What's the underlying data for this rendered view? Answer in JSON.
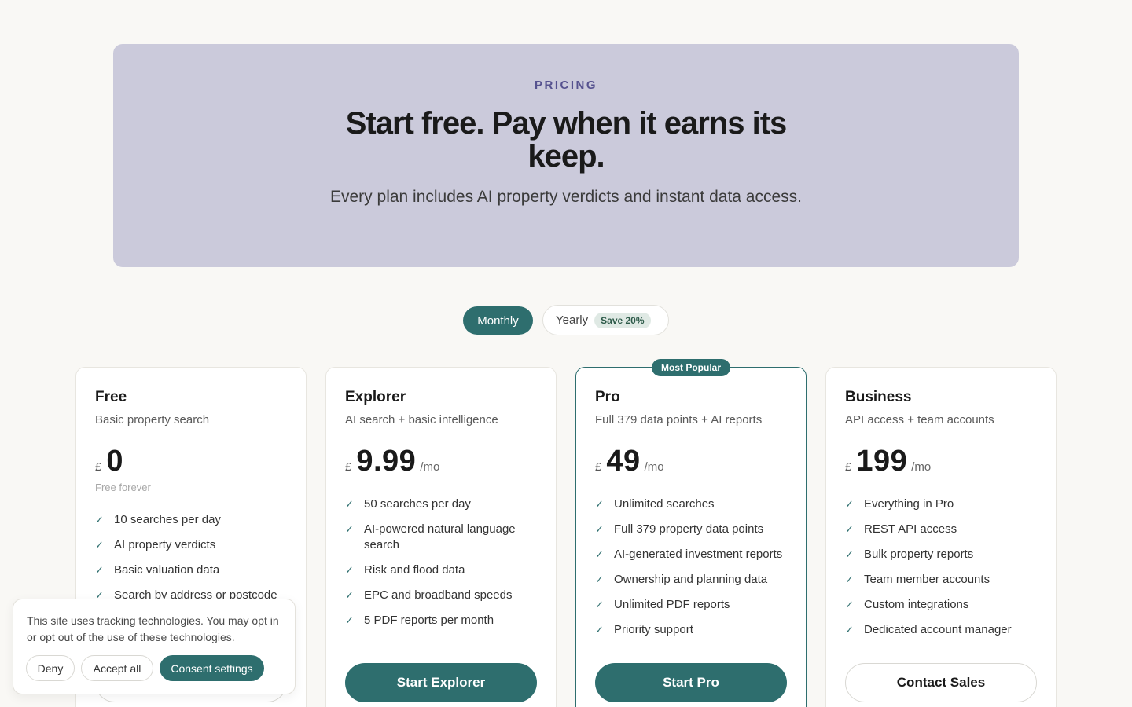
{
  "hero": {
    "eyebrow": "PRICING",
    "title": "Start free. Pay when it earns its keep.",
    "subtitle": "Every plan includes AI property verdicts and instant data access."
  },
  "billing_toggle": {
    "monthly_label": "Monthly",
    "yearly_label": "Yearly",
    "save_badge": "Save 20%",
    "selected": "Monthly"
  },
  "colors": {
    "accent": "#2e6e6e",
    "hero_bg": "#cbcadb",
    "eyebrow": "#56528f",
    "page_bg": "#f9f8f5"
  },
  "plans": [
    {
      "name": "Free",
      "description": "Basic property search",
      "currency": "£",
      "price": "0",
      "period": "",
      "note": "Free forever",
      "features": [
        "10 searches per day",
        "AI property verdicts",
        "Basic valuation data",
        "Search by address or postcode"
      ],
      "cta": ""
    },
    {
      "name": "Explorer",
      "description": "AI search + basic intelligence",
      "currency": "£",
      "price": "9.99",
      "period": "/mo",
      "features": [
        "50 searches per day",
        "AI-powered natural language search",
        "Risk and flood data",
        "EPC and broadband speeds",
        "5 PDF reports per month"
      ],
      "cta": "Start Explorer"
    },
    {
      "name": "Pro",
      "badge": "Most Popular",
      "description": "Full 379 data points + AI reports",
      "currency": "£",
      "price": "49",
      "period": "/mo",
      "features": [
        "Unlimited searches",
        "Full 379 property data points",
        "AI-generated investment reports",
        "Ownership and planning data",
        "Unlimited PDF reports",
        "Priority support"
      ],
      "cta": "Start Pro"
    },
    {
      "name": "Business",
      "description": "API access + team accounts",
      "currency": "£",
      "price": "199",
      "period": "/mo",
      "features": [
        "Everything in Pro",
        "REST API access",
        "Bulk property reports",
        "Team member accounts",
        "Custom integrations",
        "Dedicated account manager"
      ],
      "cta": "Contact Sales"
    }
  ],
  "cookie_banner": {
    "text": "This site uses tracking technologies. You may opt in or opt out of the use of these technologies.",
    "deny_label": "Deny",
    "accept_label": "Accept all",
    "settings_label": "Consent settings"
  }
}
